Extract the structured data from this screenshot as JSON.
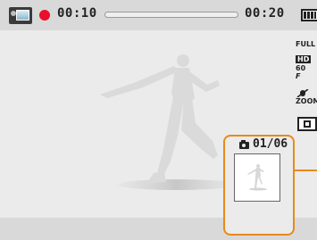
{
  "recording": {
    "elapsed": "00:10",
    "total": "00:20",
    "progress": 0.0
  },
  "status_icons": {
    "resolution_line1": "FULL",
    "resolution_line2": "HD",
    "fps_value": "60",
    "fps_symbol": "F",
    "zoom_label": "ZOOM"
  },
  "snapshot": {
    "count": "01/06"
  },
  "colors": {
    "record": "#e8102a",
    "highlight": "#e88a1a"
  },
  "icons": [
    "video-mode-icon",
    "record-dot-icon",
    "battery-icon",
    "full-hd-icon",
    "fps-icon",
    "zoom-mute-icon",
    "metering-icon",
    "camera-icon"
  ]
}
